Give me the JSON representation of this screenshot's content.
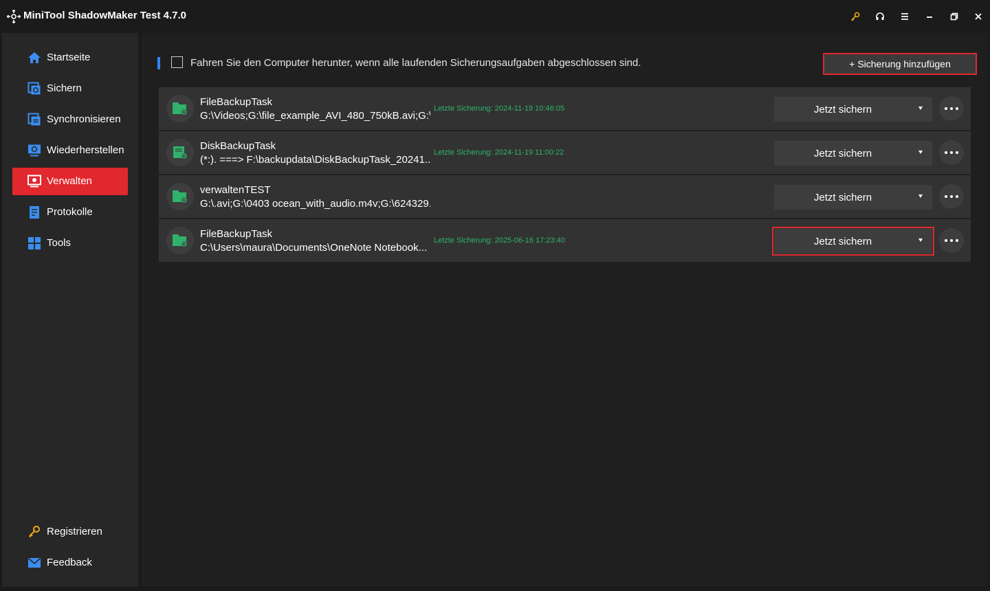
{
  "window": {
    "title": "MiniTool ShadowMaker Test 4.7.0",
    "controls": [
      "key-icon",
      "headset-icon",
      "menu-icon",
      "minimize-icon",
      "restore-icon",
      "close-icon"
    ]
  },
  "sidebar": {
    "items": [
      {
        "label": "Startseite",
        "icon": "home-icon",
        "active": false
      },
      {
        "label": "Sichern",
        "icon": "backup-icon",
        "active": false
      },
      {
        "label": "Synchronisieren",
        "icon": "sync-icon",
        "active": false
      },
      {
        "label": "Wiederherstellen",
        "icon": "restore-icon",
        "active": false
      },
      {
        "label": "Verwalten",
        "icon": "manage-icon",
        "active": true
      },
      {
        "label": "Protokolle",
        "icon": "logs-icon",
        "active": false
      },
      {
        "label": "Tools",
        "icon": "tools-icon",
        "active": false
      }
    ],
    "bottom": [
      {
        "label": "Registrieren",
        "icon": "key-icon"
      },
      {
        "label": "Feedback",
        "icon": "mail-icon"
      }
    ]
  },
  "main": {
    "shutdown_label": "Fahren Sie den Computer herunter, wenn alle laufenden Sicherungsaufgaben abgeschlossen sind.",
    "shutdown_checked": false,
    "add_button": "+ Sicherung hinzufügen",
    "tasks": [
      {
        "name": "FileBackupTask",
        "path": "G:\\Videos;G:\\file_example_AVI_480_750kB.avi;G:\\...",
        "last": "Letzte Sicherung: 2024-11-19 10:46:05",
        "button": "Jetzt sichern"
      },
      {
        "name": "DiskBackupTask",
        "path": "(*:). ===> F:\\backupdata\\DiskBackupTask_20241...",
        "last": "Letzte Sicherung: 2024-11-19 11:00:22",
        "button": "Jetzt sichern"
      },
      {
        "name": "verwaltenTEST",
        "path": "G:\\.avi;G:\\0403 ocean_with_audio.m4v;G:\\624329...",
        "last": "",
        "button": "Jetzt sichern"
      },
      {
        "name": "FileBackupTask",
        "path": "C:\\Users\\maura\\Documents\\OneNote Notebook...",
        "last": "Letzte Sicherung: 2025-06-16 17:23:40",
        "button": "Jetzt sichern"
      }
    ]
  },
  "colors": {
    "accent_red": "#e0282e",
    "accent_blue": "#2f86f6",
    "success_green": "#2fb36a",
    "icon_blue": "#3b8ef0"
  }
}
